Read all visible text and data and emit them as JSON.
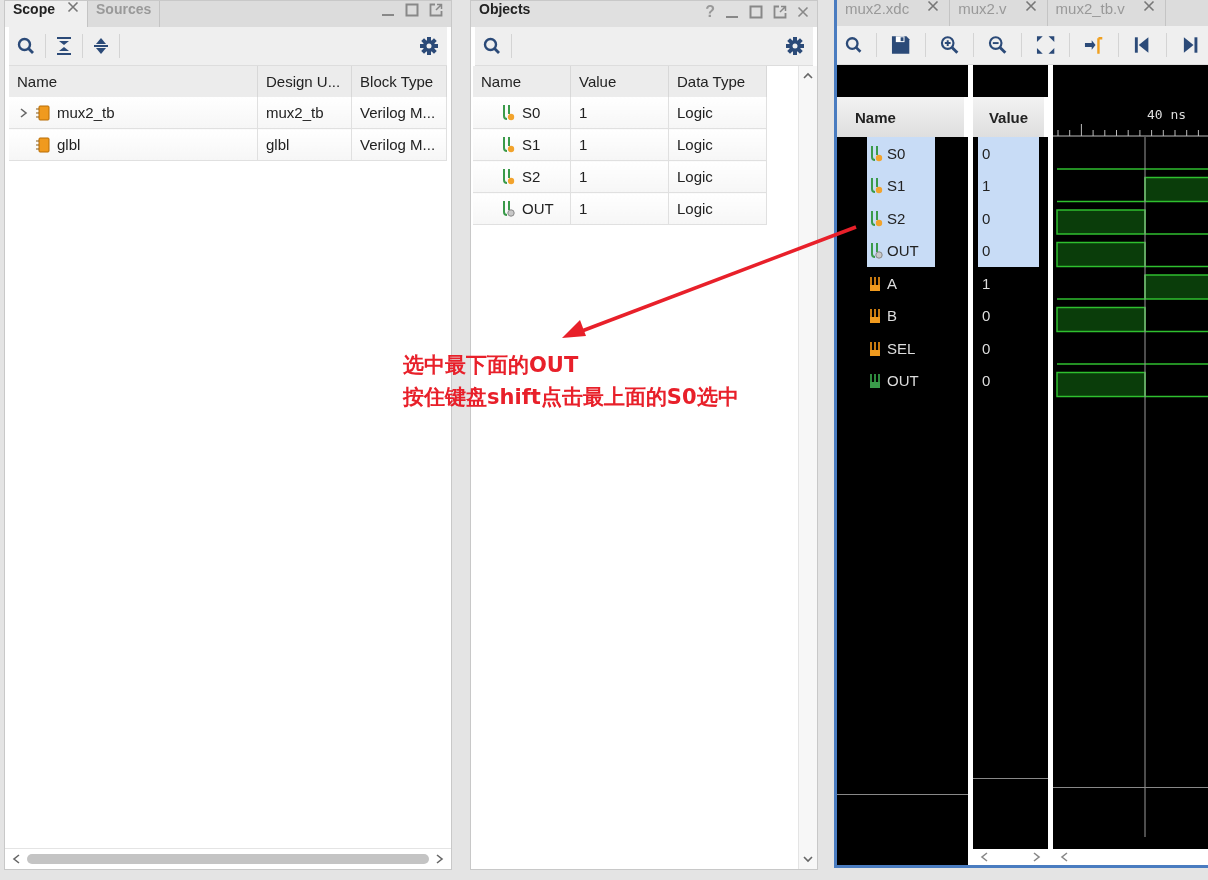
{
  "scope_panel": {
    "tabs": [
      {
        "label": "Scope",
        "selected": true
      },
      {
        "label": "Sources",
        "selected": false
      }
    ],
    "columns": [
      "Name",
      "Design U...",
      "Block Type"
    ],
    "rows": [
      {
        "name": "mux2_tb",
        "design_unit": "mux2_tb",
        "block_type": "Verilog M...",
        "expanded": false
      },
      {
        "name": "glbl",
        "design_unit": "glbl",
        "block_type": "Verilog M..."
      }
    ]
  },
  "objects_panel": {
    "title": "Objects",
    "help": "?",
    "columns": [
      "Name",
      "Value",
      "Data Type"
    ],
    "rows": [
      {
        "name": "S0",
        "value": "1",
        "data_type": "Logic",
        "kind": "input"
      },
      {
        "name": "S1",
        "value": "1",
        "data_type": "Logic",
        "kind": "input"
      },
      {
        "name": "S2",
        "value": "1",
        "data_type": "Logic",
        "kind": "input"
      },
      {
        "name": "OUT",
        "value": "1",
        "data_type": "Logic",
        "kind": "output"
      }
    ]
  },
  "wave_panel": {
    "tabs": [
      {
        "label": "mux2.xdc",
        "selected": false
      },
      {
        "label": "mux2.v",
        "selected": false
      },
      {
        "label": "mux2_tb.v",
        "selected": false
      }
    ],
    "name_header": "Name",
    "value_header": "Value",
    "time_label": "40 ns",
    "signals": [
      {
        "name": "S0",
        "value": "0",
        "kind": "input",
        "selected": true
      },
      {
        "name": "S1",
        "value": "1",
        "kind": "input",
        "selected": true
      },
      {
        "name": "S2",
        "value": "0",
        "kind": "input",
        "selected": true
      },
      {
        "name": "OUT",
        "value": "0",
        "kind": "output",
        "selected": true
      },
      {
        "name": "A",
        "value": "1",
        "kind": "reg",
        "selected": false
      },
      {
        "name": "B",
        "value": "0",
        "kind": "reg",
        "selected": false
      },
      {
        "name": "SEL",
        "value": "0",
        "kind": "reg",
        "selected": false
      },
      {
        "name": "OUT",
        "value": "0",
        "kind": "wire",
        "selected": false
      }
    ]
  },
  "annotation": {
    "lines": [
      "选中最下面的OUT",
      "按住键盘shift点击最上面的S0选中"
    ]
  }
}
